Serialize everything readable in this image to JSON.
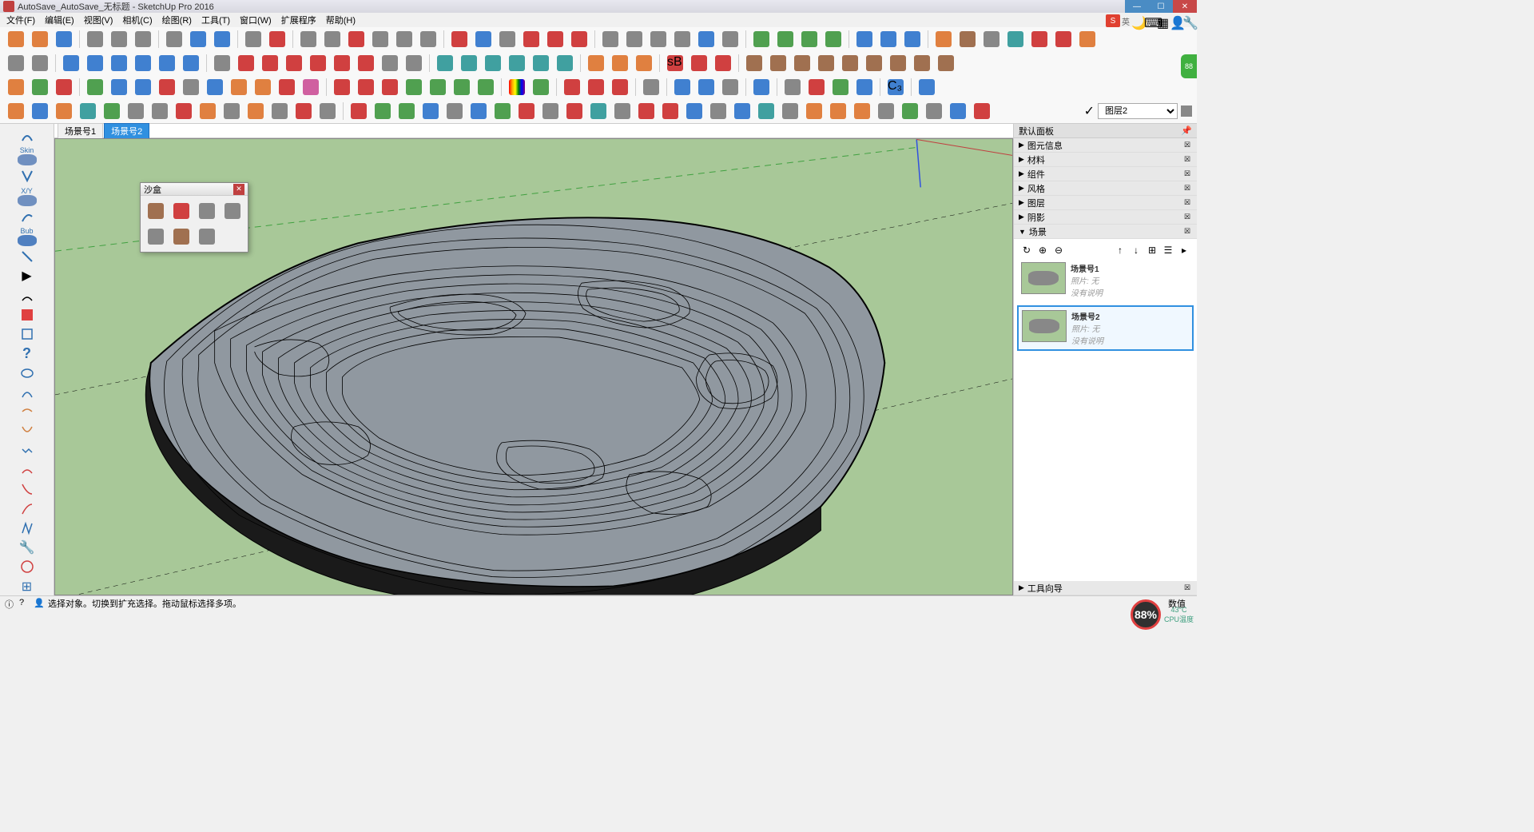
{
  "window": {
    "title": "AutoSave_AutoSave_无标题 - SketchUp Pro 2016"
  },
  "menu": {
    "file": "文件(F)",
    "edit": "编辑(E)",
    "view": "视图(V)",
    "camera": "相机(C)",
    "draw": "绘图(R)",
    "tools": "工具(T)",
    "window": "窗口(W)",
    "extensions": "扩展程序",
    "help": "帮助(H)"
  },
  "ime": {
    "brand": "S",
    "lang": "英"
  },
  "layer": {
    "current": "图层2"
  },
  "scene_tabs": {
    "tab1": "场景号1",
    "tab2": "场景号2"
  },
  "sandbox": {
    "title": "沙盒"
  },
  "left_tools": {
    "skin": "Skin",
    "xy": "X/Y",
    "bub": "Bub"
  },
  "right_panel": {
    "title": "默认面板",
    "entity_info": "图元信息",
    "materials": "材料",
    "components": "组件",
    "styles": "风格",
    "layers": "图层",
    "shadows": "阴影",
    "scenes": "场景",
    "instructor": "工具向导"
  },
  "scenes": {
    "scene1": {
      "name": "场景号1",
      "photo": "照片: 无",
      "desc": "没有说明"
    },
    "scene2": {
      "name": "场景号2",
      "photo": "照片: 无",
      "desc": "没有说明"
    }
  },
  "status": {
    "message": "选择对象。切换到扩充选择。拖动鼠标选择多项。",
    "measurement_label": "数值"
  },
  "tray": {
    "cpu_percent": "88%",
    "temp": "43°C",
    "temp_label": "CPU温度"
  },
  "side_widget": {
    "value": "88"
  }
}
